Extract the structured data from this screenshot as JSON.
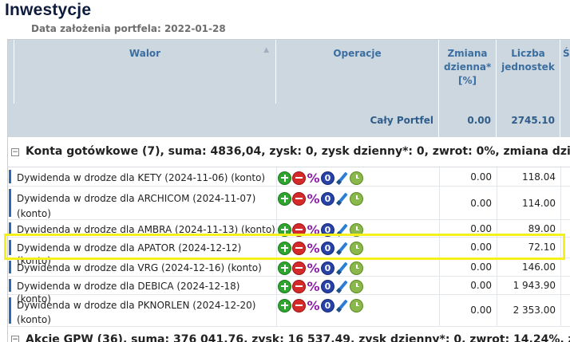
{
  "page": {
    "title": "Inwestycje",
    "subtitle": "Data założenia portfela: 2022-01-28"
  },
  "table": {
    "columns": {
      "walor": "Walor",
      "operacje": "Operacje",
      "zmiana": "Zmiana dzienna* [%]",
      "liczba": "Liczba jednostek",
      "partial": "Śr"
    },
    "total": {
      "label": "Cały Portfel",
      "zmiana": "0.00",
      "liczba": "2745.10"
    },
    "groups": [
      {
        "label": "Konta gotówkowe (7), suma: 4836,04, zysk: 0, zysk dzienny*: 0, zwrot: 0%, zmiana dzie"
      },
      {
        "label": "Akcje GPW (36), suma: 376 041,76, zysk: 16 537,49, zysk dzienny*: 0, zwrot: 14,24%, zmia"
      }
    ],
    "rows": [
      {
        "name": "Dywidenda w drodze dla KETY (2024-11-06) (konto)",
        "zmiana": "0.00",
        "liczba": "118.04"
      },
      {
        "name": "Dywidenda w drodze dla ARCHICOM (2024-11-07) (konto)",
        "zmiana": "0.00",
        "liczba": "114.00"
      },
      {
        "name": "Dywidenda w drodze dla AMBRA (2024-11-13) (konto)",
        "zmiana": "0.00",
        "liczba": "89.00"
      },
      {
        "name": "Dywidenda w drodze dla APATOR (2024-12-12) (konto)",
        "zmiana": "0.00",
        "liczba": "72.10"
      },
      {
        "name": "Dywidenda w drodze dla VRG (2024-12-16) (konto)",
        "zmiana": "0.00",
        "liczba": "146.00"
      },
      {
        "name": "Dywidenda w drodze dla DEBICA (2024-12-18) (konto)",
        "zmiana": "0.00",
        "liczba": "1 943.90"
      },
      {
        "name": "Dywidenda w drodze dla PKNORLEN (2024-12-20) (konto)",
        "zmiana": "0.00",
        "liczba": "2 353.00"
      }
    ],
    "op_icons": [
      "add-icon",
      "remove-icon",
      "percent-icon",
      "zero-icon",
      "edit-icon",
      "history-icon"
    ],
    "op_zero_glyph": "0",
    "op_percent_glyph": "%",
    "toggle_glyph": "−"
  },
  "colors": {
    "header_bg": "#cdd7e0",
    "header_text": "#3b6ea0",
    "row_marker": "#2e69b3",
    "highlight": "#f5ef1a"
  }
}
